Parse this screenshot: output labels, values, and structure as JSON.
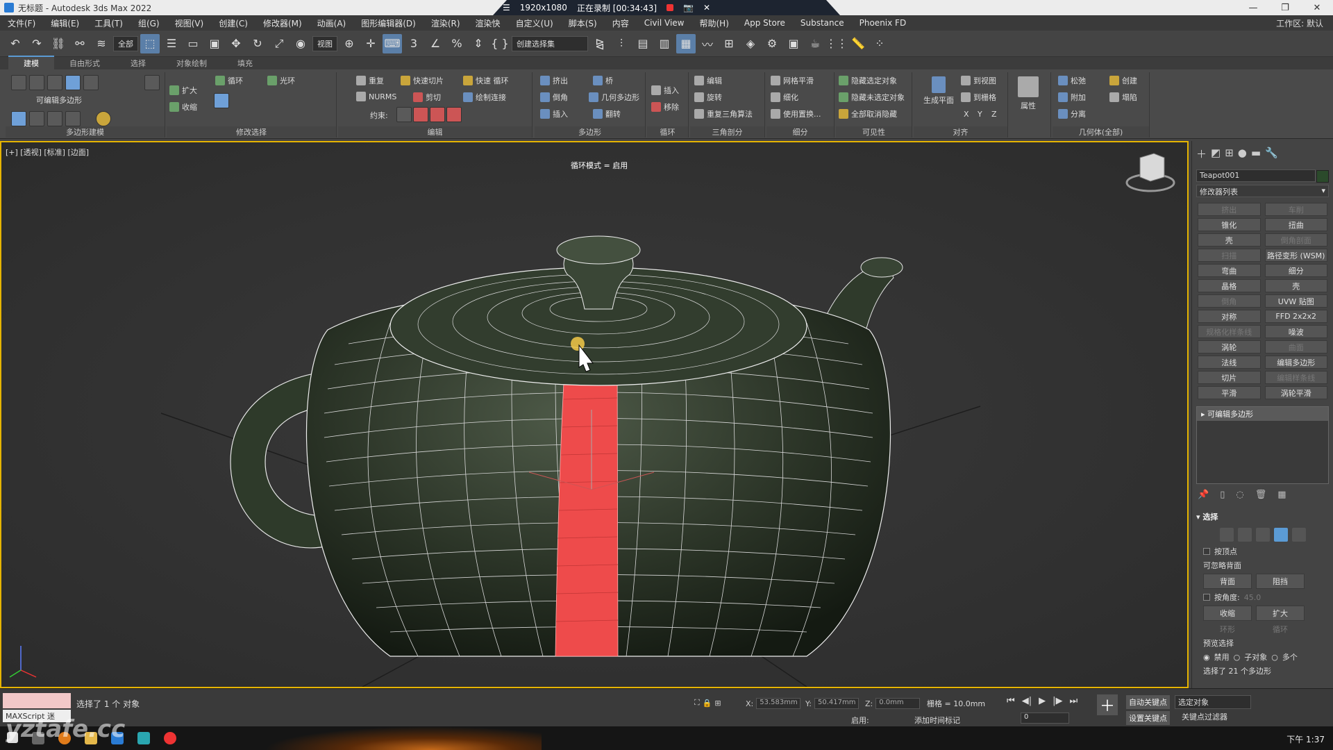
{
  "window": {
    "title": "无标题 - Autodesk 3ds Max 2022",
    "controls": [
      "—",
      "❐",
      "✕"
    ]
  },
  "recorder": {
    "resolution": "1920x1080",
    "status": "正在录制 [00:34:43]"
  },
  "menu": {
    "items": [
      "文件(F)",
      "编辑(E)",
      "工具(T)",
      "组(G)",
      "视图(V)",
      "创建(C)",
      "修改器(M)",
      "动画(A)",
      "图形编辑器(D)",
      "渲染(R)",
      "渲染快",
      "自定义(U)",
      "脚本(S)",
      "内容",
      "Civil View",
      "帮助(H)",
      "App Store",
      "Substance",
      "Phoenix FD"
    ],
    "workspace_label": "工作区: 默认"
  },
  "toolbar": {
    "filter_value": "全部",
    "view_value": "视图",
    "selection_set": "创建选择集"
  },
  "ribbon": {
    "tabs": [
      "建模",
      "自由形式",
      "选择",
      "对象绘制",
      "填充"
    ],
    "groups": {
      "poly_modeling": {
        "title": "多边形建模",
        "editable_poly": "可编辑多边形"
      },
      "modify_sel": {
        "title": "修改选择",
        "grow": "扩大",
        "shrink": "收缩",
        "loop": "循环",
        "ring": "光环"
      },
      "edit": {
        "title": "编辑",
        "repeat": "重复",
        "quickslice": "快速切片",
        "swiftloop": "快速 循环",
        "nurms": "NURMS",
        "cut": "剪切",
        "paintconnect": "绘制连接",
        "constraints": "约束:"
      },
      "polygons": {
        "title": "多边形",
        "extrude": "挤出",
        "bridge": "桥",
        "bevel": "倒角",
        "geopoly": "几何多边形",
        "inset": "插入",
        "flip": "翻转"
      },
      "loops": {
        "title": "循环",
        "insert": "插入",
        "remove": "移除"
      },
      "tris": {
        "title": "三角剖分",
        "edit": "编辑",
        "turn": "旋转",
        "retri": "重复三角算法"
      },
      "subdiv": {
        "title": "细分",
        "meshsmooth": "网格平滑",
        "tessellate": "细化",
        "usedisp": "使用置换..."
      },
      "visibility": {
        "title": "可见性",
        "hidesel": "隐藏选定对象",
        "hideunsel": "隐藏未选定对象",
        "unhideall": "全部取消隐藏"
      },
      "align": {
        "title": "对齐",
        "makeplanar": "生成平面",
        "toview": "到视图",
        "togrid": "到栅格",
        "x": "X",
        "y": "Y",
        "z": "Z"
      },
      "props": {
        "title": "属性"
      },
      "geometry": {
        "title": "几何体(全部)",
        "relax": "松弛",
        "create": "创建",
        "attach": "附加",
        "collapse": "塌陷",
        "detach": "分离"
      }
    }
  },
  "viewport": {
    "label": "[+] [透视] [标准] [边面]",
    "message": "循环模式 = 启用"
  },
  "command_panel": {
    "object_name": "Teapot001",
    "object_color": "#2b4a2b",
    "modifier_list": "修改器列表",
    "modifier_buttons": [
      {
        "label": "挤出",
        "enabled": false
      },
      {
        "label": "车削",
        "enabled": false
      },
      {
        "label": "锥化",
        "enabled": true
      },
      {
        "label": "扭曲",
        "enabled": true
      },
      {
        "label": "壳",
        "enabled": true
      },
      {
        "label": "倒角剖面",
        "enabled": false
      },
      {
        "label": "扫描",
        "enabled": false
      },
      {
        "label": "路径变形 (WSM)",
        "enabled": true
      },
      {
        "label": "弯曲",
        "enabled": true
      },
      {
        "label": "细分",
        "enabled": true
      },
      {
        "label": "晶格",
        "enabled": true
      },
      {
        "label": "壳",
        "enabled": true
      },
      {
        "label": "倒角",
        "enabled": false
      },
      {
        "label": "UVW 贴图",
        "enabled": true
      },
      {
        "label": "对称",
        "enabled": true
      },
      {
        "label": "FFD 2x2x2",
        "enabled": true
      },
      {
        "label": "规格化样条线",
        "enabled": false
      },
      {
        "label": "噪波",
        "enabled": true
      },
      {
        "label": "涡轮",
        "enabled": true
      },
      {
        "label": "曲面",
        "enabled": false
      },
      {
        "label": "法线",
        "enabled": true
      },
      {
        "label": "编辑多边形",
        "enabled": true
      },
      {
        "label": "切片",
        "enabled": true
      },
      {
        "label": "编辑样条线",
        "enabled": false
      },
      {
        "label": "平滑",
        "enabled": true
      },
      {
        "label": "涡轮平滑",
        "enabled": true
      }
    ],
    "stack_item": "可编辑多边形",
    "selection": {
      "title": "选择",
      "by_vertex": "按顶点",
      "ignore_backfacing": "可忽略背面",
      "backface": "背面",
      "occluded": "阻挡",
      "by_angle": "按角度:",
      "angle_value": "45.0",
      "shrink": "收缩",
      "grow": "扩大",
      "ring": "环形",
      "loop": "循环",
      "preview": "预览选择",
      "disabled": "禁用",
      "subobject": "子对象",
      "multi": "多个",
      "selected_count": "选择了 21 个多边形"
    }
  },
  "status": {
    "maxscript": "MAXScript 迷",
    "selection_msg": "选择了 1 个 对象",
    "x": "53.583mm",
    "y": "50.417mm",
    "z": "0.0mm",
    "grid": "栅格 = 10.0mm",
    "enable": "启用:",
    "add_time_tag": "添加时间标记",
    "frame": "0",
    "auto_key": "自动关键点",
    "set_key": "设置关键点",
    "key_selection": "选定对象",
    "key_filters": "关键点过滤器"
  },
  "taskbar": {
    "clock": "下午 1:37"
  },
  "watermark": "yztafe.cc"
}
